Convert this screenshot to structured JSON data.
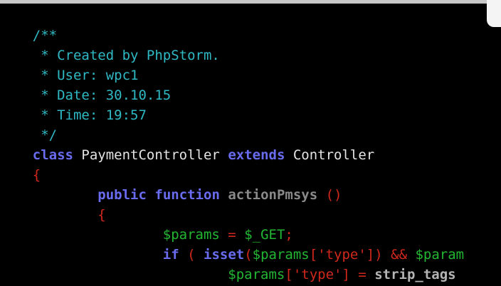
{
  "editor": {
    "lines": [
      {
        "indent": "    ",
        "tokens": [
          {
            "cls": "tok-comment",
            "text": "/**"
          }
        ]
      },
      {
        "indent": "    ",
        "tokens": [
          {
            "cls": "tok-comment",
            "text": " * Created by PhpStorm."
          }
        ]
      },
      {
        "indent": "    ",
        "tokens": [
          {
            "cls": "tok-comment",
            "text": " * User: wpc1"
          }
        ]
      },
      {
        "indent": "    ",
        "tokens": [
          {
            "cls": "tok-comment",
            "text": " * Date: 30.10.15"
          }
        ]
      },
      {
        "indent": "    ",
        "tokens": [
          {
            "cls": "tok-comment",
            "text": " * Time: 19:57"
          }
        ]
      },
      {
        "indent": "    ",
        "tokens": [
          {
            "cls": "tok-comment",
            "text": " */"
          }
        ]
      },
      {
        "indent": "    ",
        "tokens": [
          {
            "cls": "tok-keyword",
            "text": "class"
          },
          {
            "cls": "tok-class",
            "text": " PaymentController "
          },
          {
            "cls": "tok-keyword",
            "text": "extends"
          },
          {
            "cls": "tok-class",
            "text": " Controller"
          }
        ]
      },
      {
        "indent": "    ",
        "tokens": [
          {
            "cls": "tok-brace",
            "text": "{"
          }
        ]
      },
      {
        "indent": "            ",
        "tokens": [
          {
            "cls": "tok-keyword",
            "text": "public"
          },
          {
            "cls": "tok-plain",
            "text": " "
          },
          {
            "cls": "tok-keyword",
            "text": "function"
          },
          {
            "cls": "tok-plain",
            "text": " "
          },
          {
            "cls": "tok-method",
            "text": "actionPmsys"
          },
          {
            "cls": "tok-plain",
            "text": " "
          },
          {
            "cls": "tok-paren",
            "text": "()"
          }
        ]
      },
      {
        "indent": "            ",
        "tokens": [
          {
            "cls": "tok-brace",
            "text": "{"
          }
        ]
      },
      {
        "indent": "                    ",
        "tokens": [
          {
            "cls": "tok-var",
            "text": "$params"
          },
          {
            "cls": "tok-op",
            "text": " = "
          },
          {
            "cls": "tok-var",
            "text": "$_GET"
          },
          {
            "cls": "tok-op",
            "text": ";"
          }
        ]
      },
      {
        "indent": "                    ",
        "tokens": [
          {
            "cls": "tok-keyword",
            "text": "if"
          },
          {
            "cls": "tok-op",
            "text": " ( "
          },
          {
            "cls": "tok-keyword",
            "text": "isset"
          },
          {
            "cls": "tok-op",
            "text": "("
          },
          {
            "cls": "tok-var",
            "text": "$params"
          },
          {
            "cls": "tok-string",
            "text": "['type']"
          },
          {
            "cls": "tok-op",
            "text": ") && "
          },
          {
            "cls": "tok-var",
            "text": "$param"
          }
        ]
      },
      {
        "indent": "                            ",
        "tokens": [
          {
            "cls": "tok-var",
            "text": "$params"
          },
          {
            "cls": "tok-string",
            "text": "['type']"
          },
          {
            "cls": "tok-op",
            "text": " = "
          },
          {
            "cls": "tok-call",
            "text": "strip_tags"
          }
        ]
      }
    ]
  }
}
